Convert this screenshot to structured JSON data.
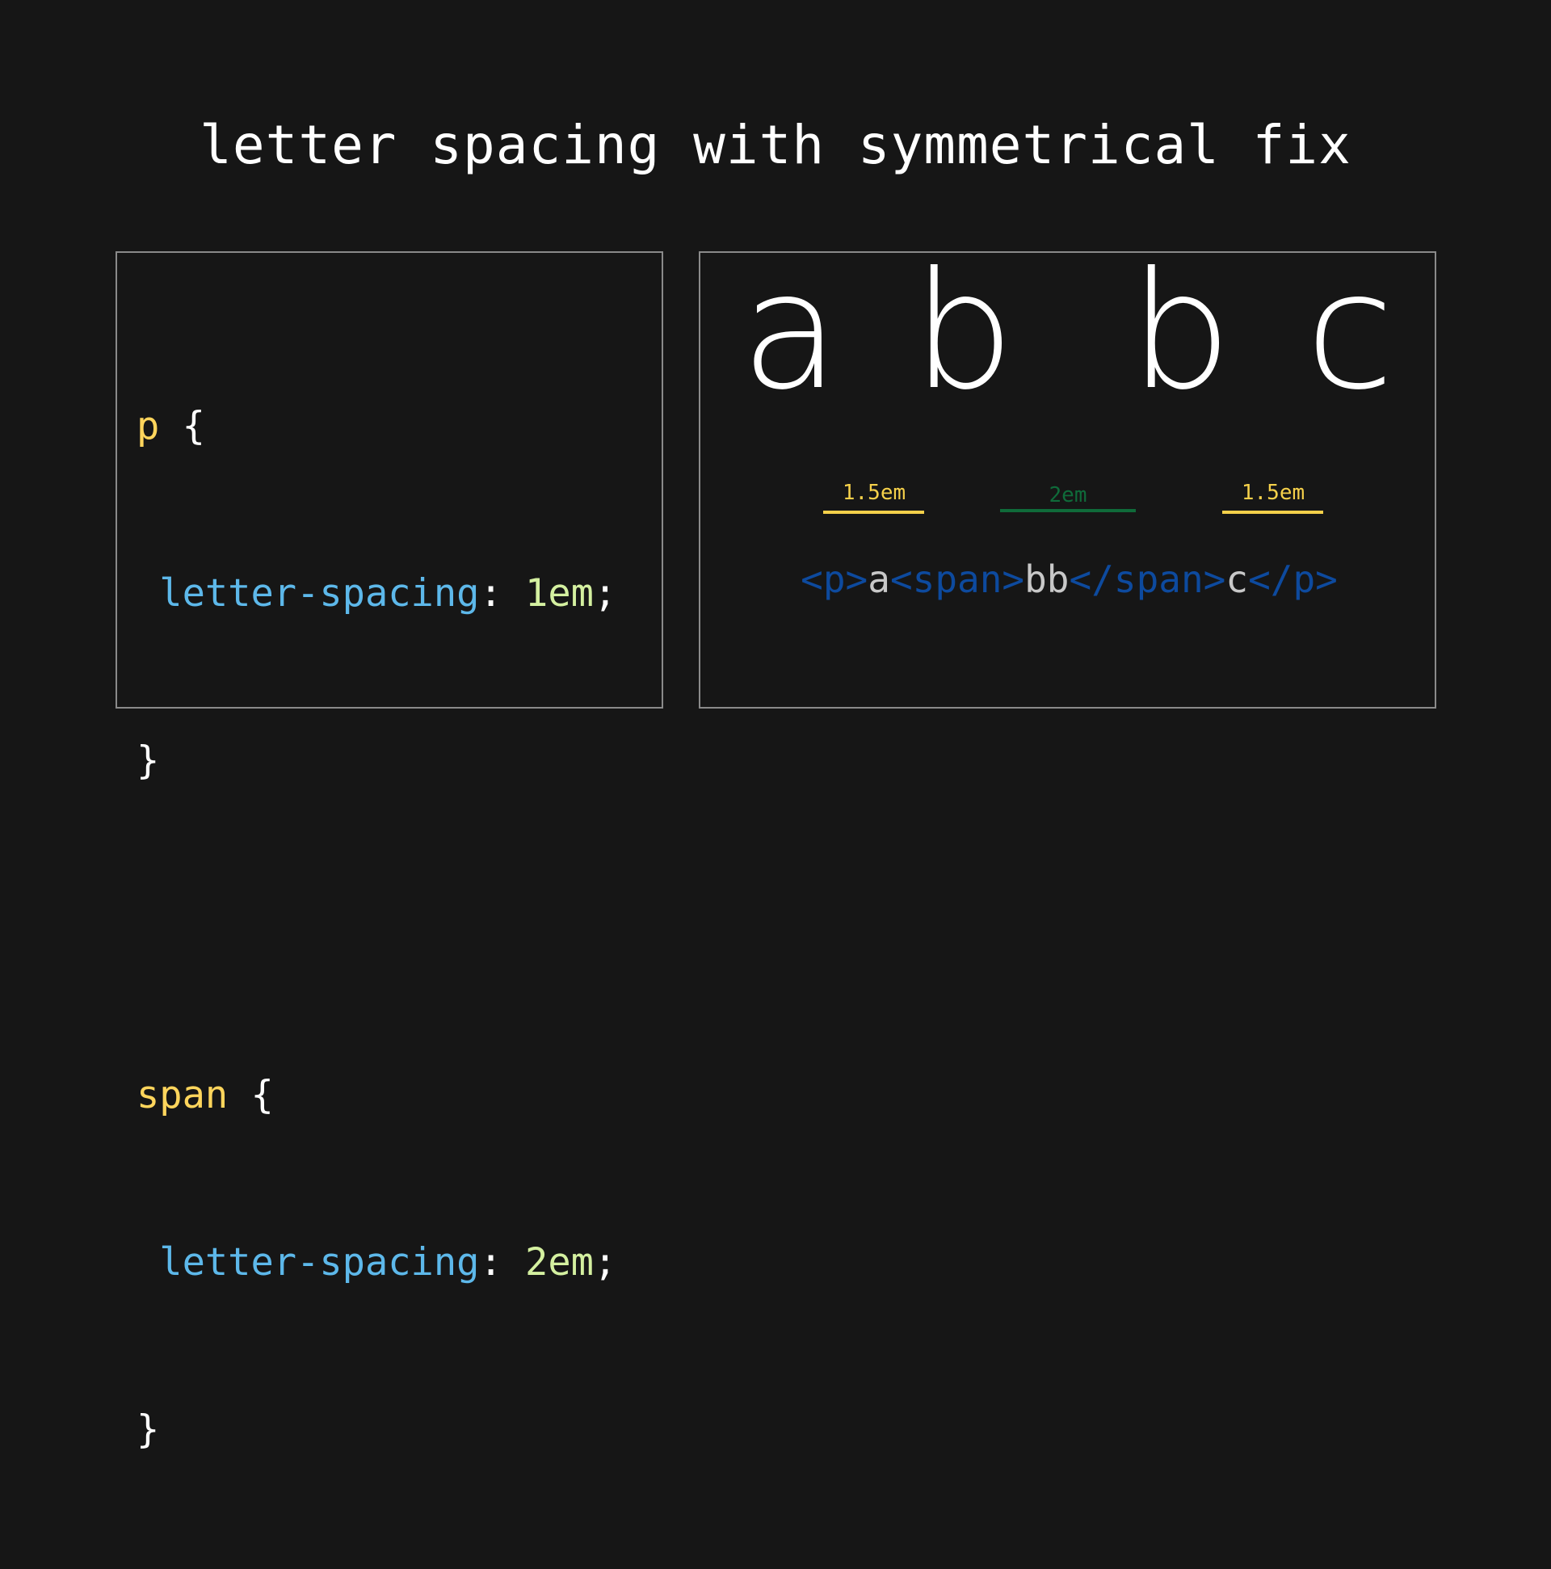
{
  "title": "letter spacing with symmetrical fix",
  "colors": {
    "background": "#161616",
    "selector": "#ffd55c",
    "property": "#5db8ea",
    "value": "#d4f0a0",
    "tag": "#0d4a9e",
    "text": "#c8c8c8",
    "marker_yellow": "#f5d04a",
    "marker_green": "#0f6b3a"
  },
  "css_code": {
    "rules": [
      {
        "selector": "p",
        "open": " {",
        "property": "letter-spacing",
        "colon": ": ",
        "value": "1em",
        "semicolon": ";",
        "close": "}"
      },
      {
        "selector": "span",
        "open": " {",
        "property": "letter-spacing",
        "colon": ": ",
        "value": "2em",
        "semicolon": ";",
        "close": "}"
      }
    ]
  },
  "demo": {
    "letters": [
      "a",
      "b",
      "b",
      "c"
    ],
    "gaps": [
      {
        "label": "1.5em",
        "color": "yellow"
      },
      {
        "label": "2em",
        "color": "green"
      },
      {
        "label": "1.5em",
        "color": "yellow"
      }
    ],
    "html_tokens": [
      {
        "text": "<p>",
        "kind": "tag"
      },
      {
        "text": "a",
        "kind": "txt"
      },
      {
        "text": "<span>",
        "kind": "tag"
      },
      {
        "text": "bb",
        "kind": "txt"
      },
      {
        "text": "</span>",
        "kind": "tag"
      },
      {
        "text": "c",
        "kind": "txt"
      },
      {
        "text": "</p>",
        "kind": "tag"
      }
    ]
  }
}
